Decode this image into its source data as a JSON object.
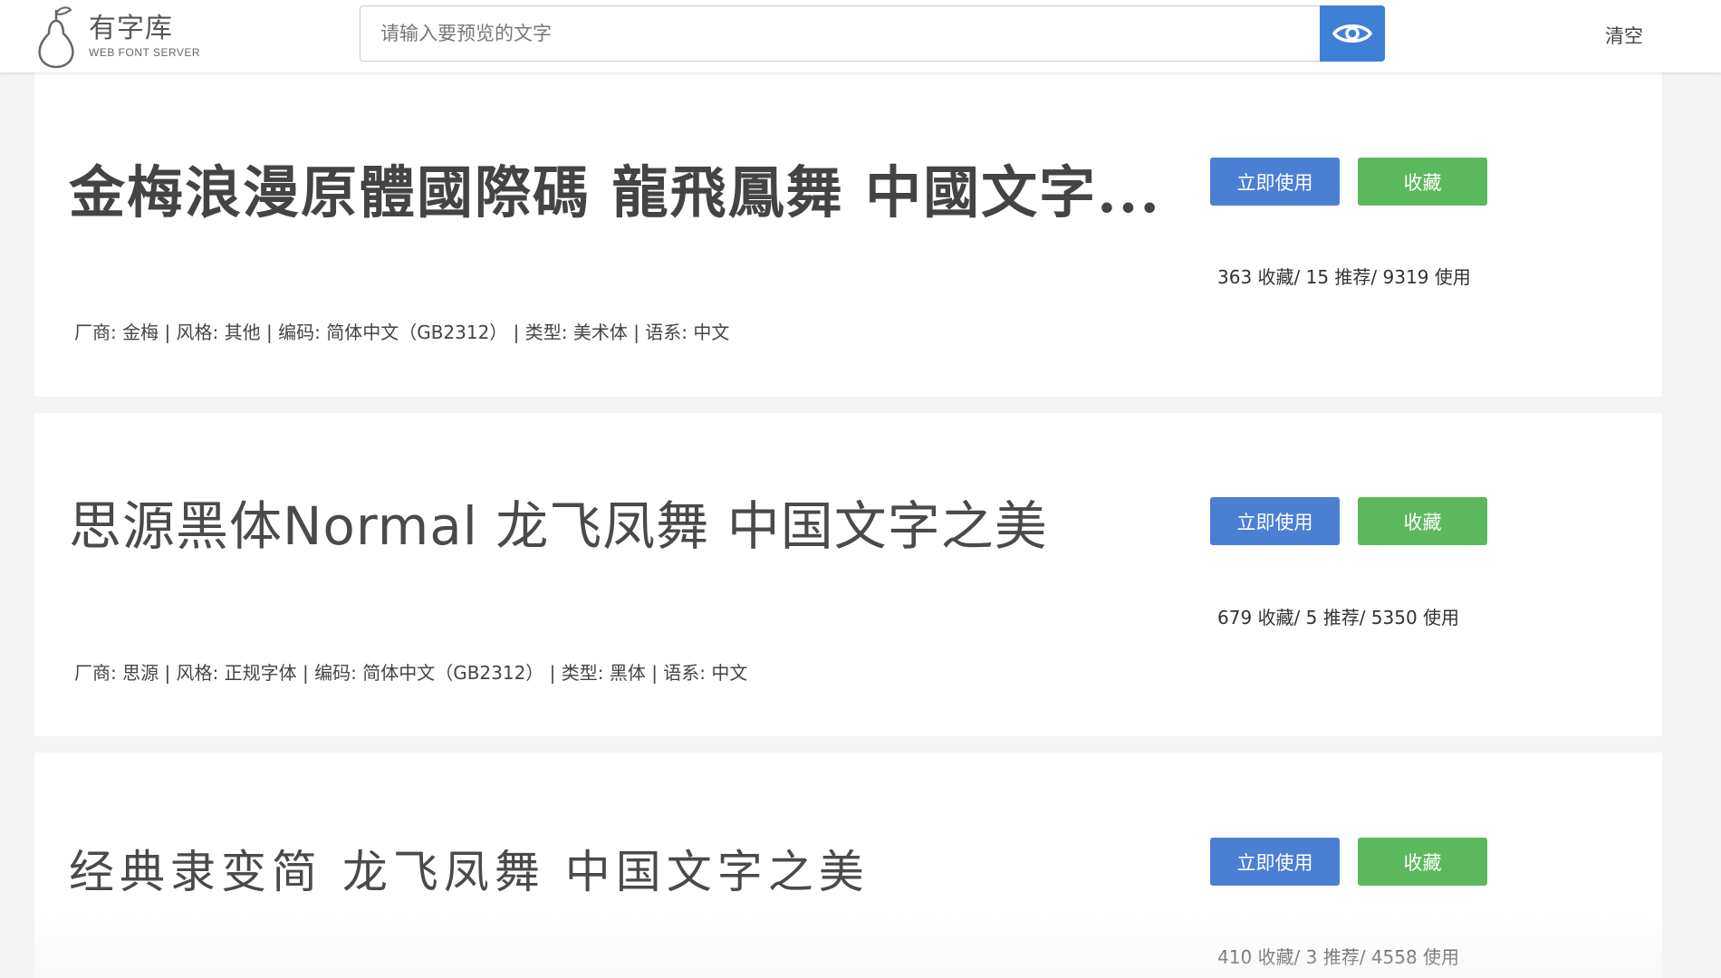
{
  "header": {
    "logo_title": "有字库",
    "logo_subtitle": "WEB FONT SERVER",
    "search_placeholder": "请输入要预览的文字",
    "preview_icon": "eye-icon",
    "clear_label": "清空",
    "accent_color": "#3f7fd6"
  },
  "fonts": [
    {
      "preview": "金梅浪漫原體國際碼 龍飛鳳舞 中國文字...",
      "use_label": "立即使用",
      "fav_label": "收藏",
      "stats": "363 收藏/ 15 推荐/ 9319 使用",
      "meta": "厂商: 金梅 |  风格: 其他 |  编码: 简体中文（GB2312） |  类型: 美术体 |  语系: 中文"
    },
    {
      "preview": "思源黑体Normal  龙飞凤舞  中国文字之美",
      "use_label": "立即使用",
      "fav_label": "收藏",
      "stats": "679 收藏/ 5 推荐/ 5350 使用",
      "meta": "厂商: 思源 |  风格: 正规字体 |  编码: 简体中文（GB2312） |  类型: 黑体 |  语系: 中文"
    },
    {
      "preview": "经典隶变简  龙飞凤舞  中国文字之美",
      "use_label": "立即使用",
      "fav_label": "收藏",
      "stats": "410 收藏/ 3 推荐/ 4558 使用",
      "meta": ""
    }
  ],
  "colors": {
    "use_button": "#4a7fd4",
    "fav_button": "#5cb85c"
  }
}
